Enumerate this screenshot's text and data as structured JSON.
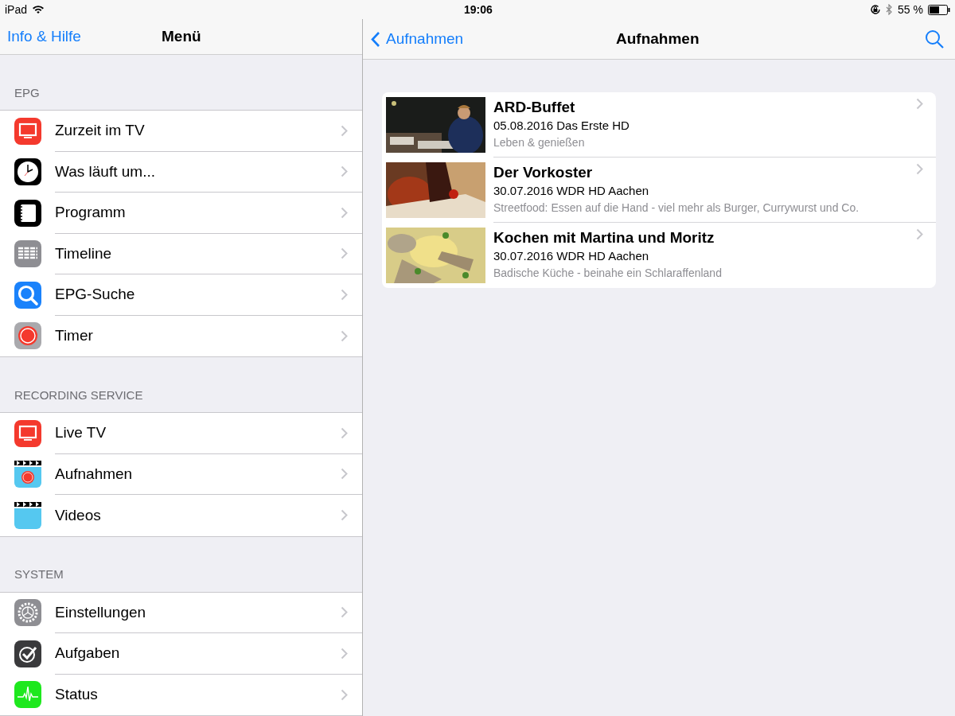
{
  "status_bar": {
    "device": "iPad",
    "time": "19:06",
    "battery": "55 %"
  },
  "menu": {
    "back_link": "Info & Hilfe",
    "title": "Menü",
    "sections": [
      {
        "header": "EPG",
        "items": [
          {
            "label": "Zurzeit im TV"
          },
          {
            "label": "Was läuft um..."
          },
          {
            "label": "Programm"
          },
          {
            "label": "Timeline"
          },
          {
            "label": "EPG-Suche"
          },
          {
            "label": "Timer"
          }
        ]
      },
      {
        "header": "RECORDING SERVICE",
        "items": [
          {
            "label": "Live TV"
          },
          {
            "label": "Aufnahmen"
          },
          {
            "label": "Videos"
          }
        ]
      },
      {
        "header": "SYSTEM",
        "items": [
          {
            "label": "Einstellungen"
          },
          {
            "label": "Aufgaben"
          },
          {
            "label": "Status"
          }
        ]
      }
    ]
  },
  "detail": {
    "back_link": "Aufnahmen",
    "title": "Aufnahmen",
    "recordings": [
      {
        "title": "ARD-Buffet",
        "info": "05.08.2016 Das Erste HD",
        "subtitle": "Leben & genießen"
      },
      {
        "title": "Der Vorkoster",
        "info": "30.07.2016 WDR HD Aachen",
        "subtitle": "Streetfood: Essen auf die Hand - viel mehr als Burger, Currywurst und Co."
      },
      {
        "title": "Kochen mit Martina und Moritz",
        "info": "30.07.2016 WDR HD Aachen",
        "subtitle": "Badische Küche - beinahe ein Schlaraffenland"
      }
    ]
  }
}
